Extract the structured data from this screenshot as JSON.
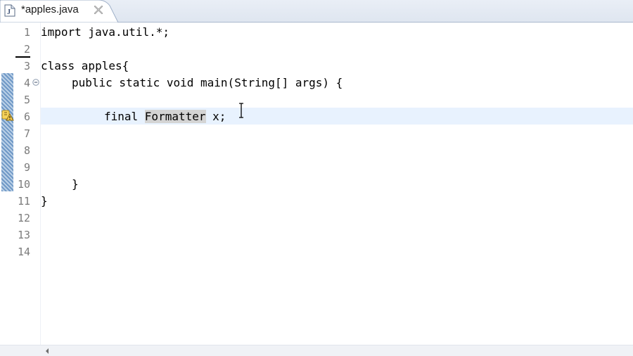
{
  "tab": {
    "label": "*apples.java",
    "file_icon": "java-file-icon",
    "close_icon": "close-icon"
  },
  "editor": {
    "line_numbers": [
      "1",
      "2",
      "3",
      "4",
      "5",
      "6",
      "7",
      "8",
      "9",
      "10",
      "11",
      "12",
      "13",
      "14"
    ],
    "lines": {
      "l1": "import java.util.*;",
      "l3": "class apples{",
      "l4": "public static void main(String[] args) {",
      "l6_prefix": "final ",
      "l6_highlight": "Formatter",
      "l6_suffix": " x;",
      "l10": "}",
      "l11": "}"
    },
    "current_line": 6,
    "warning_icon": "quick-fix-warning-icon",
    "fold_icon": "collapse-icon",
    "accent_color": "#7fa6cf",
    "current_line_color": "#e8f2fe"
  }
}
